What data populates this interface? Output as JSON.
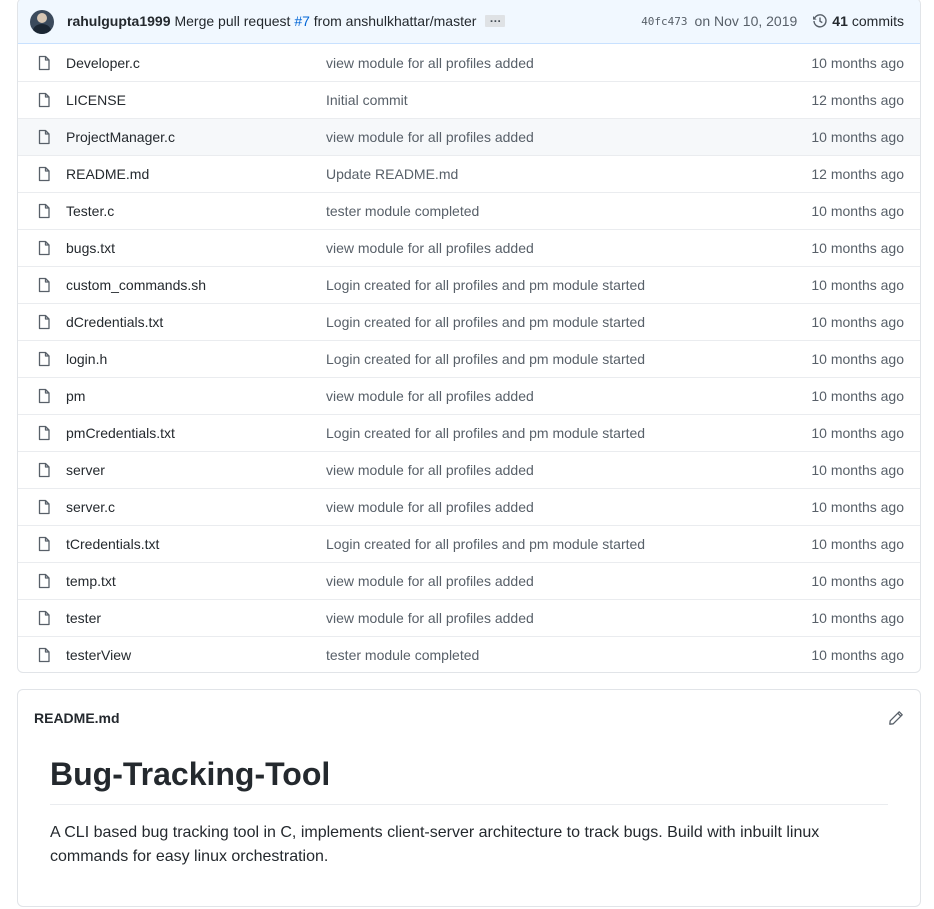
{
  "commit": {
    "author": "rahulgupta1999",
    "message_prefix": "Merge pull request",
    "pr_number": "#7",
    "message_suffix": "from anshulkhattar/master",
    "ellipsis": "…",
    "sha": "40fc473",
    "date": "on Nov 10, 2019",
    "commit_count": "41",
    "commits_label": "commits"
  },
  "files": [
    {
      "name": "Developer.c",
      "message": "view module for all profiles added",
      "age": "10 months ago"
    },
    {
      "name": "LICENSE",
      "message": "Initial commit",
      "age": "12 months ago"
    },
    {
      "name": "ProjectManager.c",
      "message": "view module for all profiles added",
      "age": "10 months ago"
    },
    {
      "name": "README.md",
      "message": "Update README.md",
      "age": "12 months ago"
    },
    {
      "name": "Tester.c",
      "message": "tester module completed",
      "age": "10 months ago"
    },
    {
      "name": "bugs.txt",
      "message": "view module for all profiles added",
      "age": "10 months ago"
    },
    {
      "name": "custom_commands.sh",
      "message": "Login created for all profiles and pm module started",
      "age": "10 months ago"
    },
    {
      "name": "dCredentials.txt",
      "message": "Login created for all profiles and pm module started",
      "age": "10 months ago"
    },
    {
      "name": "login.h",
      "message": "Login created for all profiles and pm module started",
      "age": "10 months ago"
    },
    {
      "name": "pm",
      "message": "view module for all profiles added",
      "age": "10 months ago"
    },
    {
      "name": "pmCredentials.txt",
      "message": "Login created for all profiles and pm module started",
      "age": "10 months ago"
    },
    {
      "name": "server",
      "message": "view module for all profiles added",
      "age": "10 months ago"
    },
    {
      "name": "server.c",
      "message": "view module for all profiles added",
      "age": "10 months ago"
    },
    {
      "name": "tCredentials.txt",
      "message": "Login created for all profiles and pm module started",
      "age": "10 months ago"
    },
    {
      "name": "temp.txt",
      "message": "view module for all profiles added",
      "age": "10 months ago"
    },
    {
      "name": "tester",
      "message": "view module for all profiles added",
      "age": "10 months ago"
    },
    {
      "name": "testerView",
      "message": "tester module completed",
      "age": "10 months ago"
    }
  ],
  "readme": {
    "filename": "README.md",
    "heading": "Bug-Tracking-Tool",
    "paragraph": "A CLI based bug tracking tool in C, implements client-server architecture to track bugs. Build with inbuilt linux commands for easy linux orchestration."
  },
  "colors": {
    "link": "#0366d6",
    "muted": "#586069",
    "commit_bar_bg": "#f1f8ff"
  },
  "icons": {
    "file": "file-icon",
    "history": "history-icon",
    "edit": "pencil-icon"
  }
}
